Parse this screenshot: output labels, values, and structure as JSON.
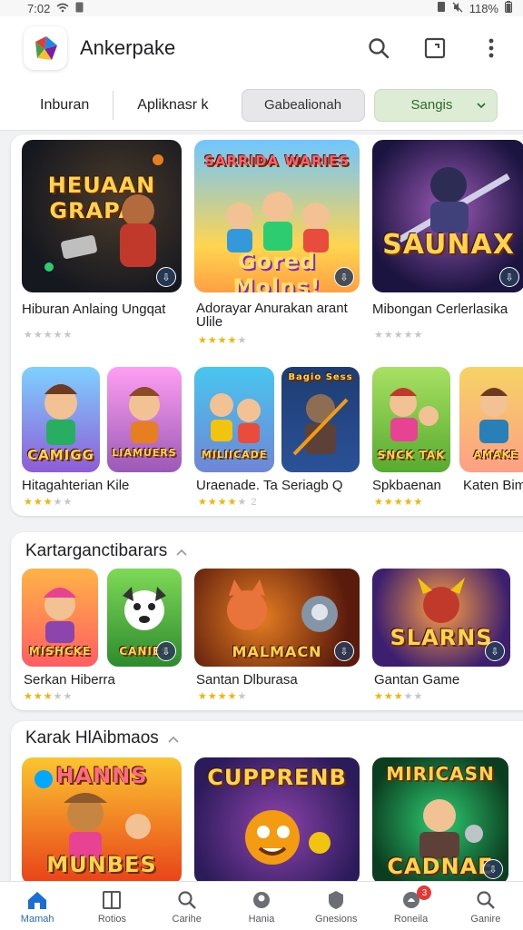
{
  "status_bar": {
    "time": "7:02",
    "battery": "118%"
  },
  "app": {
    "title": "Ankerpake"
  },
  "filters": {
    "tab_1": "Inburan",
    "tab_2": "Apliknasr k",
    "chip_1": "Gabealionah",
    "chip_2": "Sangis"
  },
  "trending": {
    "row1": [
      {
        "name": "Hiburan Anlaing Ungqat",
        "tile_text": "HEUAAN GRAPAA",
        "rating": 0,
        "accent": "#2b2f4a"
      },
      {
        "name": "Adorayar Anurakan arant Ulile",
        "tile_text_top": "SARRIDA WARIES",
        "tile_text": "Gored Molns!",
        "rating": 4,
        "accent": "#f5a623"
      },
      {
        "name": "Mibongan Cerlerlasika",
        "tile_text": "SAUNAX",
        "rating": 0,
        "accent": "#3b1f6e"
      }
    ],
    "row2": [
      {
        "name": "Hitagahterian Kile",
        "tiles": [
          "CAMIGG",
          "LIAMUERS"
        ],
        "rating": 3
      },
      {
        "name": "Uraenade. Ta Seriagb Q",
        "tiles": [
          "MILIICADE",
          "Bagio Sess"
        ],
        "rating": 4,
        "count": "2"
      },
      {
        "name": "Spkbaenan",
        "tiles": [
          "SNCK TAK",
          "AMAKE"
        ],
        "rating": 5
      },
      {
        "name": "Katen Bim"
      }
    ]
  },
  "section_kartar": {
    "title": "Kartarganctibarars",
    "items": [
      {
        "name": "Serkan Hiberra",
        "tiles": [
          "MISHCKE",
          "CANIES"
        ],
        "rating": 3
      },
      {
        "name": "Santan Dlburasa",
        "tile_text": "MALMACN",
        "rating": 4
      },
      {
        "name": "Gantan Game",
        "tile_text": "SLARNS",
        "rating": 3
      }
    ]
  },
  "section_karak": {
    "title": "Karak HlAibmaos",
    "items": [
      {
        "tile_text": "MUNBES",
        "tile_text_top": "HANNS"
      },
      {
        "tile_text": "CUPPRENB"
      },
      {
        "tile_text": "CADNAE",
        "tile_text_top": "MIRICASN"
      }
    ]
  },
  "bottom_nav": [
    {
      "label": "Mamah",
      "icon": "home-icon",
      "active": true
    },
    {
      "label": "Rotios",
      "icon": "book-icon"
    },
    {
      "label": "Carihe",
      "icon": "search-icon"
    },
    {
      "label": "Hania",
      "icon": "shield-icon"
    },
    {
      "label": "Gnesions",
      "icon": "badge-icon"
    },
    {
      "label": "Roneila",
      "icon": "bell-icon",
      "badge": "3"
    },
    {
      "label": "Ganire",
      "icon": "search-icon"
    }
  ],
  "colors": {
    "accent": "#1a6fd6",
    "star": "#f4b400",
    "chip_green": "#dcecd5"
  }
}
